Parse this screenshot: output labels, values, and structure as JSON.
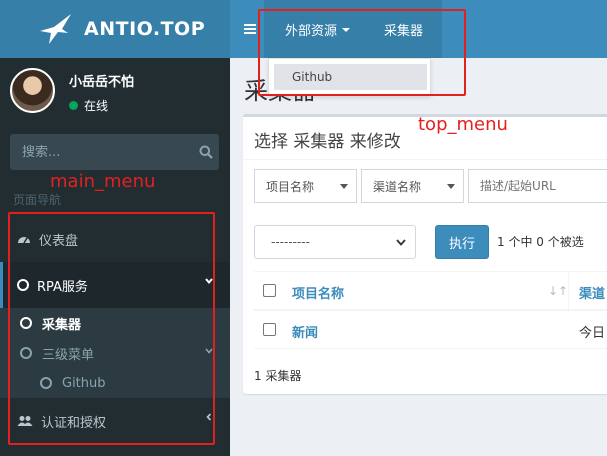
{
  "brand": {
    "name": "ANTIO.TOP"
  },
  "user": {
    "name": "小岳岳不怕",
    "status": "在线"
  },
  "search": {
    "placeholder": "搜索..."
  },
  "sidebar": {
    "header": "页面导航",
    "items": [
      {
        "label": "仪表盘",
        "icon": "dashboard-icon"
      },
      {
        "label": "RPA服务",
        "icon": "circle-icon"
      },
      {
        "label": "认证和授权",
        "icon": "users-icon"
      }
    ],
    "sub_items": [
      {
        "label": "采集器"
      },
      {
        "label": "三级菜单"
      },
      {
        "label": "Github"
      }
    ]
  },
  "topnav": {
    "dropdown_label": "外部资源",
    "link_label": "采集器",
    "dropdown_items": [
      "Github"
    ]
  },
  "page": {
    "title": "采集器"
  },
  "box": {
    "title": "选择 采集器 来修改",
    "filter_project": "项目名称",
    "filter_channel": "渠道名称",
    "description_placeholder": "描述/起始URL",
    "action_select": "---------",
    "execute_label": "执行",
    "selected_count": "1 个中 0 个被选",
    "table": {
      "headers": [
        "项目名称",
        "渠道"
      ],
      "rows": [
        {
          "name": "新闻",
          "channel": "今日"
        }
      ]
    },
    "footer": "1 采集器"
  },
  "annotations": {
    "top_menu": "top_menu",
    "main_menu": "main_menu",
    "color": "#e32020"
  },
  "colors": {
    "navbar": "#3c8dbc",
    "logo_bar": "#367fa9",
    "sidebar": "#222d32",
    "link": "#3c8dbc",
    "online": "#00a65a"
  }
}
